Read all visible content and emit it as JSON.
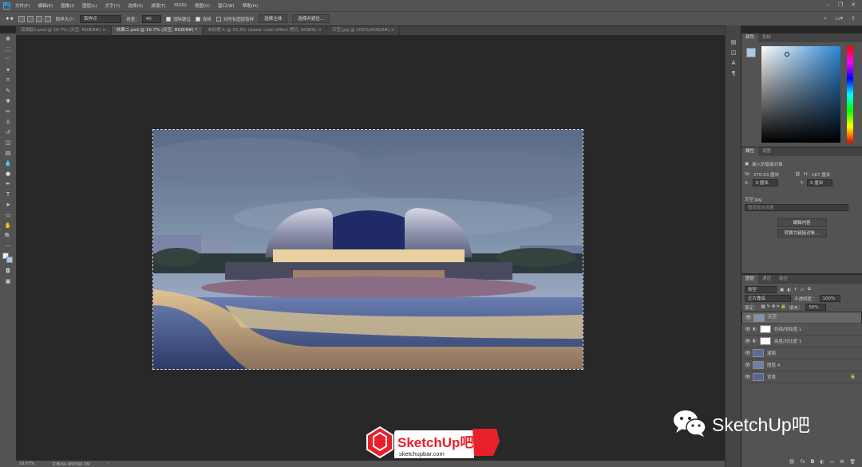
{
  "menubar": {
    "logo": "Ps",
    "items": [
      "文件(F)",
      "编辑(E)",
      "图像(I)",
      "图层(L)",
      "文字(Y)",
      "选择(S)",
      "滤镜(T)",
      "3D(D)",
      "视图(V)",
      "窗口(W)",
      "帮助(H)"
    ]
  },
  "options": {
    "feather_label": "取样大小：",
    "feather_value": "取样点",
    "tolerance_label": "容差：",
    "tolerance_value": "40",
    "antialias_label": "消除锯齿",
    "contiguous_label": "连续",
    "sample_all_label": "对所有图层取样",
    "select_subject": "选择主体",
    "select_mask": "选择并遮住..."
  },
  "tabs": [
    {
      "label": "双面胶2.psd @ 16.7% (天空, RGB/8#) ×",
      "active": false
    },
    {
      "label": "效果二.psd @ 16.7% (天空, RGB/8#) *",
      "active": true
    },
    {
      "label": "未标题-1 @ 33.3% (water color effect 拷贝, RGB/8) ×",
      "active": false
    },
    {
      "label": "天空.jpg @ 100%(RGB/8#) ×",
      "active": false
    }
  ],
  "status": {
    "zoom": "16.67%",
    "doc": "文档:64.9M/560.3M"
  },
  "color_panel": {
    "tabs": [
      "颜色",
      "色板"
    ]
  },
  "properties_panel": {
    "tabs": [
      "属性",
      "调整"
    ],
    "title": "嵌入的智能对象",
    "w_label": "W:",
    "w_value": "270.93 厘米",
    "h_label": "H:",
    "h_value": "167 厘米",
    "x_label": "X:",
    "x_value": "0 厘米",
    "y_label": "Y:",
    "y_value": "0 厘米",
    "comp_label": "天空.jpg",
    "comp_placeholder": "图层复合设置",
    "edit_button": "编辑内容",
    "convert_button": "转换为链接对象..."
  },
  "layers_panel": {
    "tabs": [
      "图层",
      "通道",
      "路径"
    ],
    "kind": "类型",
    "blend": "正片叠底",
    "opacity_label": "不透明度：",
    "opacity": "100%",
    "lock_label": "锁定：",
    "fill_label": "填充：",
    "fill": "50%",
    "layers": [
      {
        "name": "天空",
        "type": "image",
        "selected": true
      },
      {
        "name": "色相/饱和度 1",
        "type": "adjust",
        "selected": false
      },
      {
        "name": "亮度/对比度 1",
        "type": "adjust",
        "selected": false
      },
      {
        "name": "湖面",
        "type": "image",
        "selected": false
      },
      {
        "name": "图层 4",
        "type": "image",
        "selected": false
      },
      {
        "name": "背景",
        "type": "image",
        "selected": false
      }
    ]
  },
  "watermark": {
    "brand": "SketchUp吧",
    "logo_text": "SketchUp吧",
    "logo_url": "sketchupbar.com"
  }
}
